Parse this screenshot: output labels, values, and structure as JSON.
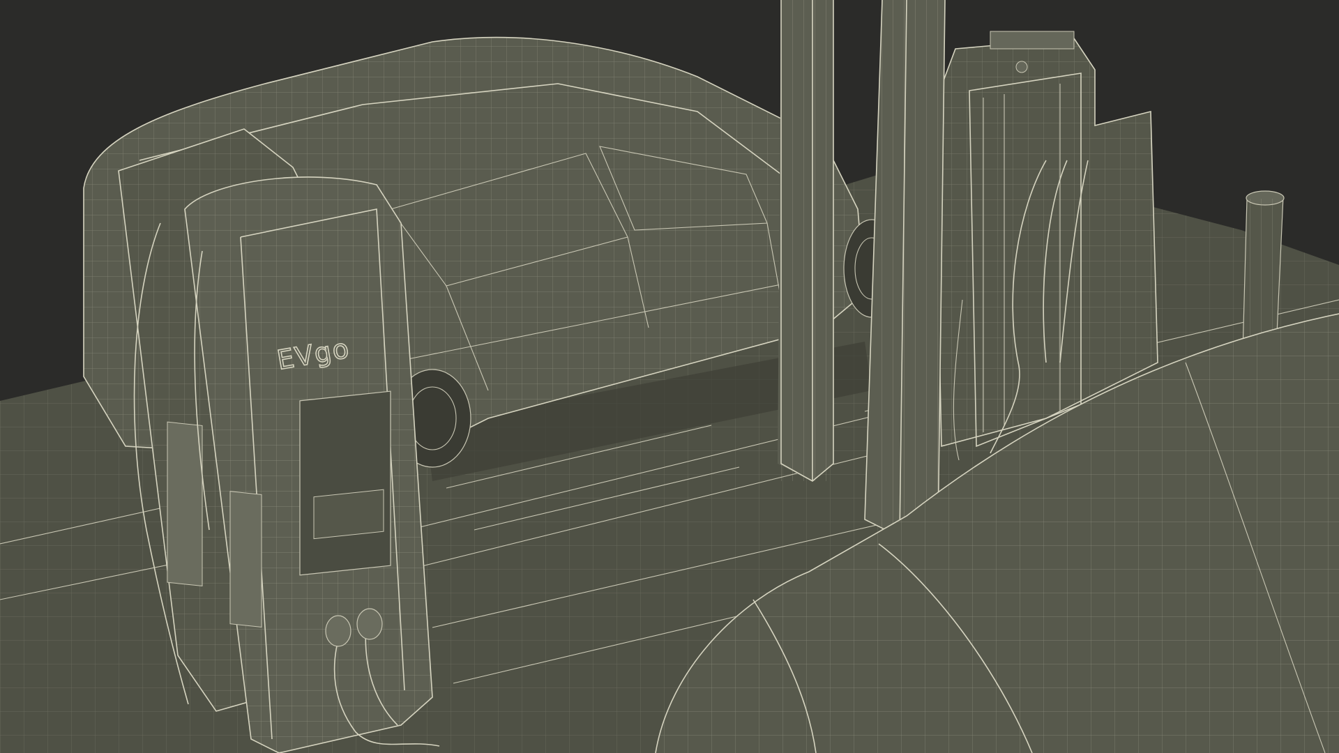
{
  "scene": {
    "background_color": "#2b2b29",
    "surface_color": "#4f5145",
    "wire_color": "#c9c7b4"
  },
  "charger_left": {
    "brand_label": "EVgo"
  }
}
